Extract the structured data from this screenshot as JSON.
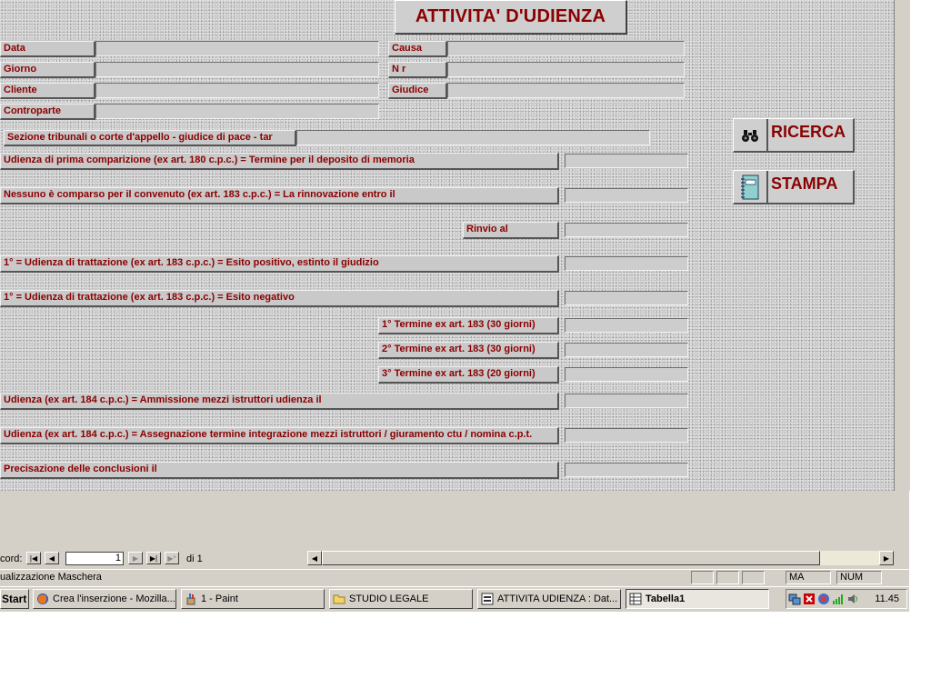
{
  "form": {
    "title": "ATTIVITA' D'UDIENZA",
    "labels": {
      "data": "Data",
      "giorno": "Giorno",
      "cliente": "Cliente",
      "controparte": "Controparte",
      "causa": "Causa",
      "nr": "N r",
      "giudice": "Giudice",
      "sezione": "Sezione tribunali o corte d'appello - giudice di pace - tar",
      "prima_comparizione": "Udienza di prima comparizione (ex art. 180 c.p.c.) = Termine per il deposito di memoria",
      "nessuno_comparso": "Nessuno è comparso per il convenuto (ex art. 183 c.p.c.) = La rinnovazione entro il",
      "rinvio": "Rinvio al",
      "trattazione_positivo": "1° = Udienza di trattazione (ex art. 183 c.p.c.) = Esito positivo, estinto il giudizio",
      "trattazione_negativo": "1° = Udienza di trattazione (ex art. 183 c.p.c.) = Esito negativo",
      "termine1": "1° Termine ex art. 183 (30 giorni)",
      "termine2": "2° Termine ex art. 183 (30 giorni)",
      "termine3": "3° Termine ex art. 183 (20 giorni)",
      "ammissione": "Udienza (ex art. 184 c.p.c.) = Ammissione mezzi istruttori udienza il",
      "assegnazione": "Udienza (ex art. 184 c.p.c.) = Assegnazione termine integrazione mezzi istruttori / giuramento ctu / nomina c.p.t.",
      "precisazione": "Precisazione delle conclusioni il"
    },
    "buttons": {
      "ricerca": "RICERCA",
      "stampa": "STAMPA"
    }
  },
  "navigation": {
    "record_label": "cord:",
    "record_value": "1",
    "of_label": "di 1",
    "first_icon": "first-record-icon",
    "prev_icon": "prev-record-icon",
    "next_icon": "next-record-icon",
    "last_icon": "last-record-icon",
    "new_icon": "new-record-icon"
  },
  "statusbar": {
    "text": "ualizzazione Maschera",
    "ma": "MA",
    "num": "NUM"
  },
  "taskbar": {
    "start": "Start",
    "tasks": [
      {
        "label": "Crea l'inserzione - Mozilla...",
        "icon": "firefox-icon"
      },
      {
        "label": "1 - Paint",
        "icon": "paint-icon"
      },
      {
        "label": "STUDIO LEGALE",
        "icon": "folder-icon"
      },
      {
        "label": "ATTIVITA UDIENZA : Dat...",
        "icon": "access-form-icon"
      },
      {
        "label": "Tabella1",
        "icon": "table-icon"
      }
    ],
    "clock": "11.45"
  },
  "colors": {
    "label_text": "#8b0000",
    "form_background": "#c8c8c8",
    "chrome": "#d4d0c8"
  }
}
